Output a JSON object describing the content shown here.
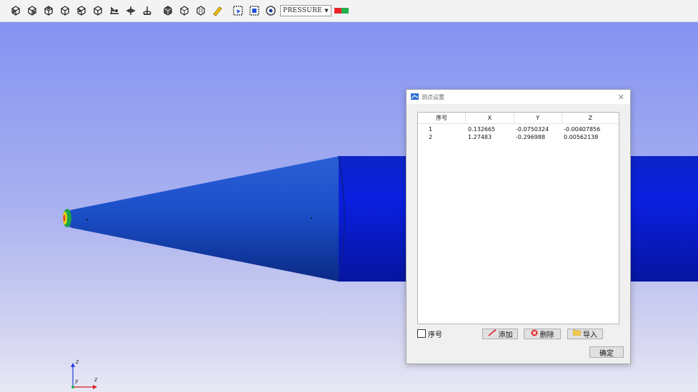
{
  "toolbar": {
    "field_value": "PRESSURE",
    "legend_colors": [
      "#e8262a",
      "#23b14d"
    ]
  },
  "viewport": {
    "axes": {
      "x": "z",
      "y": "z",
      "origin": "y"
    }
  },
  "dialog": {
    "title": "测点设置",
    "columns": [
      "序号",
      "X",
      "Y",
      "Z"
    ],
    "rows": [
      {
        "id": "1",
        "x": "0.132665",
        "y": "-0.0750324",
        "z": "-0.00407856"
      },
      {
        "id": "2",
        "x": "1.27483",
        "y": "-0.296988",
        "z": "0.00562138"
      }
    ],
    "checkbox_label": "序号",
    "add_label": "添加",
    "delete_label": "删除",
    "import_label": "导入",
    "ok_label": "确定"
  }
}
